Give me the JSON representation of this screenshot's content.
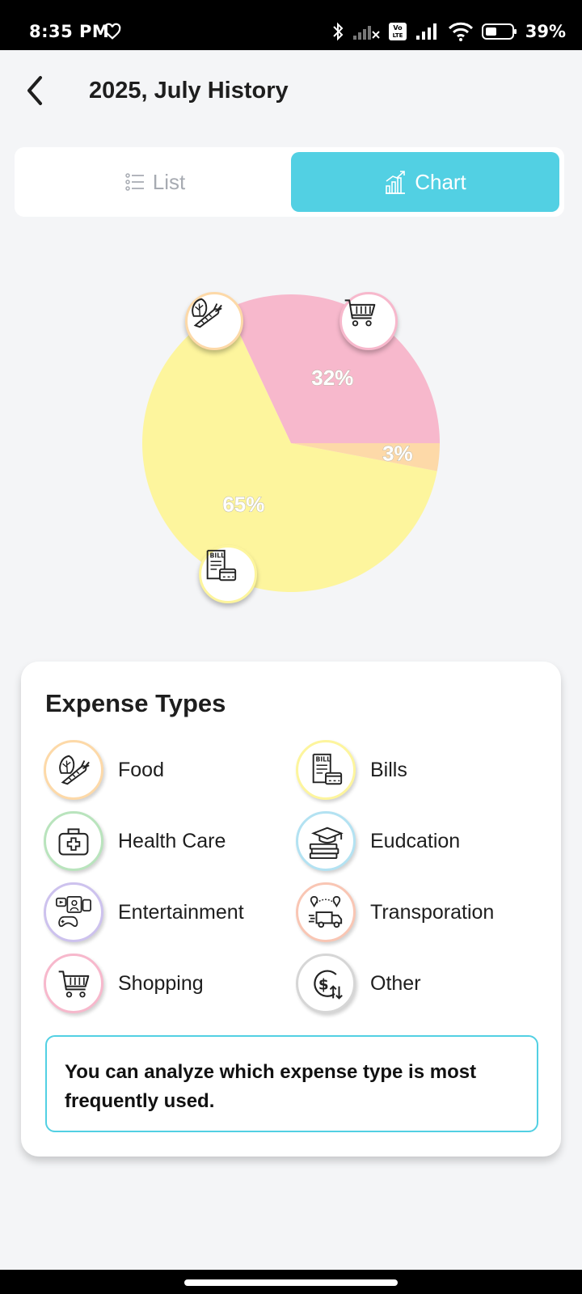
{
  "status_bar": {
    "time": "8:35 PM",
    "battery": "39%",
    "icons": [
      "heart-icon",
      "bluetooth-icon",
      "signal-x-icon",
      "volte-icon",
      "signal-icon",
      "wifi-icon",
      "battery-icon"
    ]
  },
  "header": {
    "title": "2025, July History",
    "back_icon": "chevron-left-icon"
  },
  "tabs": [
    {
      "label": "List",
      "icon": "list-icon",
      "selected": false
    },
    {
      "label": "Chart",
      "icon": "bar-chart-icon",
      "selected": true
    }
  ],
  "colors": {
    "accent": "#52d0e3",
    "food": "#fdd9a8",
    "bills": "#fdf59d",
    "health": "#b9e4bd",
    "education": "#b3e2f2",
    "entertainment": "#cdc2ee",
    "transportation": "#f9c6b4",
    "shopping": "#f7b8cc",
    "other": "#d6d6d6"
  },
  "chart_data": {
    "type": "pie",
    "slices": [
      {
        "category": "Shopping",
        "value": 32,
        "label": "32%",
        "color": "#f7b8cc",
        "icon": "shopping-cart-icon"
      },
      {
        "category": "Bills",
        "value": 65,
        "label": "65%",
        "color": "#fdf59d",
        "icon": "bill-icon"
      },
      {
        "category": "Food",
        "value": 3,
        "label": "3%",
        "color": "#fdd9a8",
        "icon": "vegetables-icon"
      }
    ]
  },
  "legend": {
    "title": "Expense Types",
    "items": [
      {
        "label": "Food",
        "icon": "vegetables-icon",
        "color": "#fdd9a8"
      },
      {
        "label": "Bills",
        "icon": "bill-icon",
        "color": "#fdf59d"
      },
      {
        "label": "Health Care",
        "icon": "medical-kit-icon",
        "color": "#b9e4bd"
      },
      {
        "label": "Eudcation",
        "icon": "graduation-books-icon",
        "color": "#b3e2f2"
      },
      {
        "label": "Entertainment",
        "icon": "entertainment-icon",
        "color": "#cdc2ee"
      },
      {
        "label": "Transporation",
        "icon": "delivery-truck-icon",
        "color": "#f9c6b4"
      },
      {
        "label": "Shopping",
        "icon": "shopping-cart-icon",
        "color": "#f7b8cc"
      },
      {
        "label": "Other",
        "icon": "money-flow-icon",
        "color": "#d6d6d6"
      }
    ]
  },
  "info_text": "You can analyze which expense type is most frequently used."
}
